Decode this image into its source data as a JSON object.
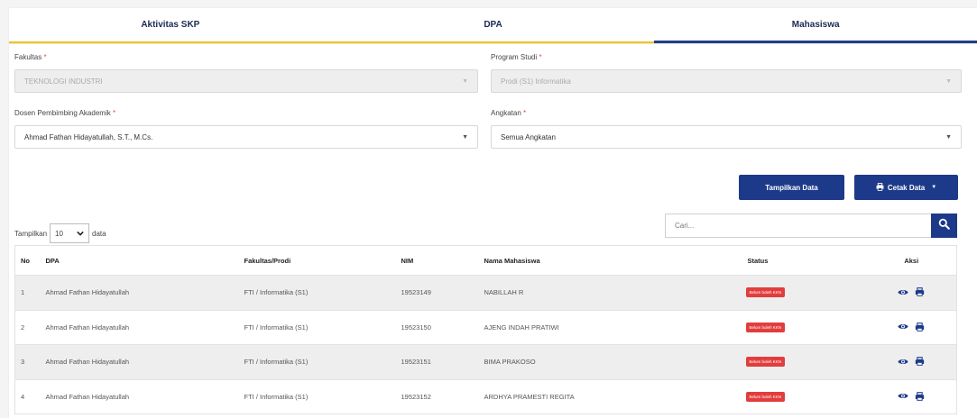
{
  "tabs": [
    {
      "label": "Aktivitas SKP"
    },
    {
      "label": "DPA"
    },
    {
      "label": "Mahasiswa"
    }
  ],
  "form": {
    "fakultas": {
      "label": "Fakultas",
      "required": "*",
      "value": "TEKNOLOGI INDUSTRI"
    },
    "program_studi": {
      "label": "Program Studi",
      "required": "*",
      "value": "Prodi (S1) Informatika"
    },
    "dosen": {
      "label": "Dosen Pembimbing Akademik",
      "required": "*",
      "value": "Ahmad Fathan Hidayatullah, S.T., M.Cs."
    },
    "angkatan": {
      "label": "Angkatan",
      "required": "*",
      "value": "Semua Angkatan"
    }
  },
  "buttons": {
    "show": "Tampilkan Data",
    "print": "Cetak Data"
  },
  "length": {
    "prefix": "Tampilkan",
    "value": "10",
    "suffix": "data"
  },
  "search": {
    "placeholder": "Cari..."
  },
  "table": {
    "headers": {
      "no": "No",
      "dpa": "DPA",
      "fakultas": "Fakultas/Prodi",
      "nim": "NIM",
      "nama": "Nama Mahasiswa",
      "status": "Status",
      "aksi": "Aksi"
    },
    "rows": [
      {
        "no": "1",
        "dpa": "Ahmad Fathan Hidayatullah",
        "fakultas": "FTI / Informatika (S1)",
        "nim": "19523149",
        "nama": "NABILLAH R",
        "status": "Belum boleh KKN"
      },
      {
        "no": "2",
        "dpa": "Ahmad Fathan Hidayatullah",
        "fakultas": "FTI / Informatika (S1)",
        "nim": "19523150",
        "nama": "AJENG INDAH PRATIWI",
        "status": "Belum boleh KKN"
      },
      {
        "no": "3",
        "dpa": "Ahmad Fathan Hidayatullah",
        "fakultas": "FTI / Informatika (S1)",
        "nim": "19523151",
        "nama": "BIMA PRAKOSO",
        "status": "Belum boleh KKN"
      },
      {
        "no": "4",
        "dpa": "Ahmad Fathan Hidayatullah",
        "fakultas": "FTI / Informatika (S1)",
        "nim": "19523152",
        "nama": "ARDHYA PRAMESTI REGITA",
        "status": "Belum boleh KKN"
      }
    ]
  },
  "colors": {
    "primary": "#1d3a8a",
    "accent": "#f0c419",
    "danger": "#e23d3d"
  },
  "icons": {
    "view": "eye-icon",
    "print": "printer-icon",
    "search": "search-icon"
  }
}
